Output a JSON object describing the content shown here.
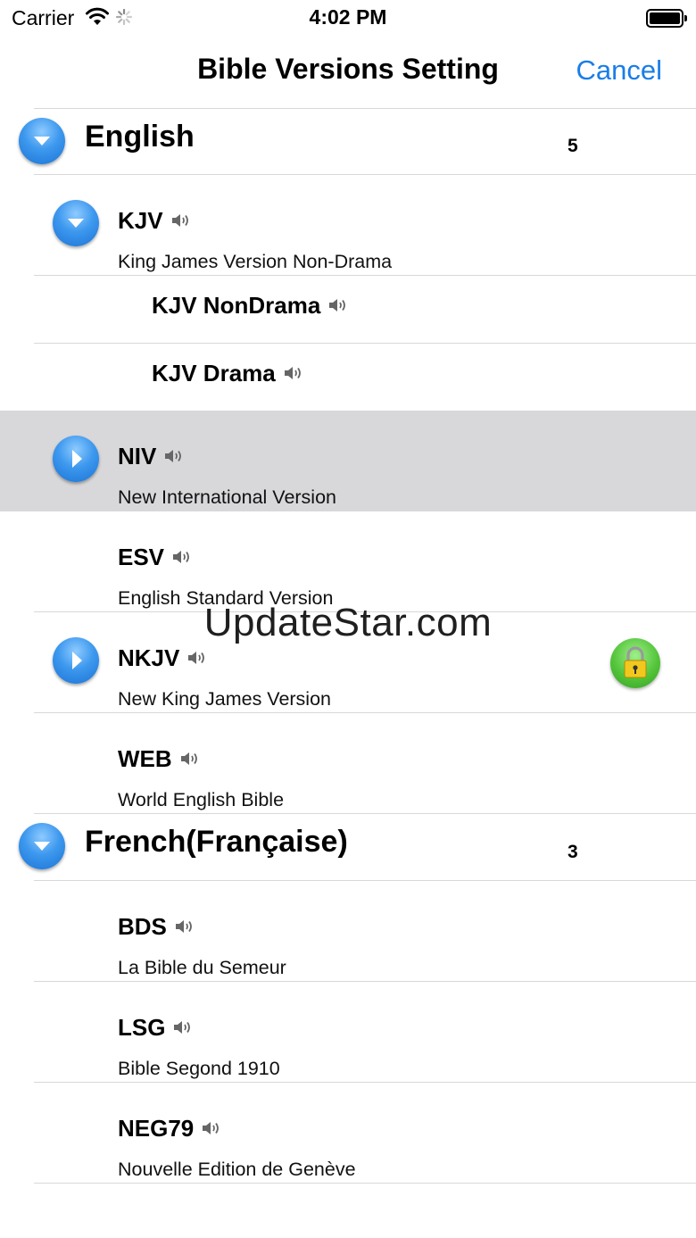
{
  "status_bar": {
    "carrier": "Carrier",
    "time": "4:02 PM"
  },
  "nav": {
    "title": "Bible Versions Setting",
    "cancel": "Cancel"
  },
  "groups": [
    {
      "name": "English",
      "count": "5"
    },
    {
      "name": "French(Française)",
      "count": "3"
    }
  ],
  "versions": {
    "kjv": {
      "code": "KJV",
      "desc": "King James Version Non-Drama"
    },
    "kjv_nondrama": {
      "code": "KJV NonDrama"
    },
    "kjv_drama": {
      "code": "KJV Drama"
    },
    "niv": {
      "code": "NIV",
      "desc": "New International Version"
    },
    "esv": {
      "code": "ESV",
      "desc": "English Standard Version"
    },
    "nkjv": {
      "code": "NKJV",
      "desc": "New King James Version"
    },
    "web": {
      "code": "WEB",
      "desc": "World English Bible"
    },
    "bds": {
      "code": "BDS",
      "desc": "La Bible du Semeur"
    },
    "lsg": {
      "code": "LSG",
      "desc": "Bible Segond 1910"
    },
    "neg79": {
      "code": "NEG79",
      "desc": "Nouvelle Edition de Genève"
    }
  },
  "watermark": "UpdateStar.com",
  "colors": {
    "accent": "#1a7de8",
    "highlight": "#d8d8da",
    "lock": "#53c43a"
  }
}
